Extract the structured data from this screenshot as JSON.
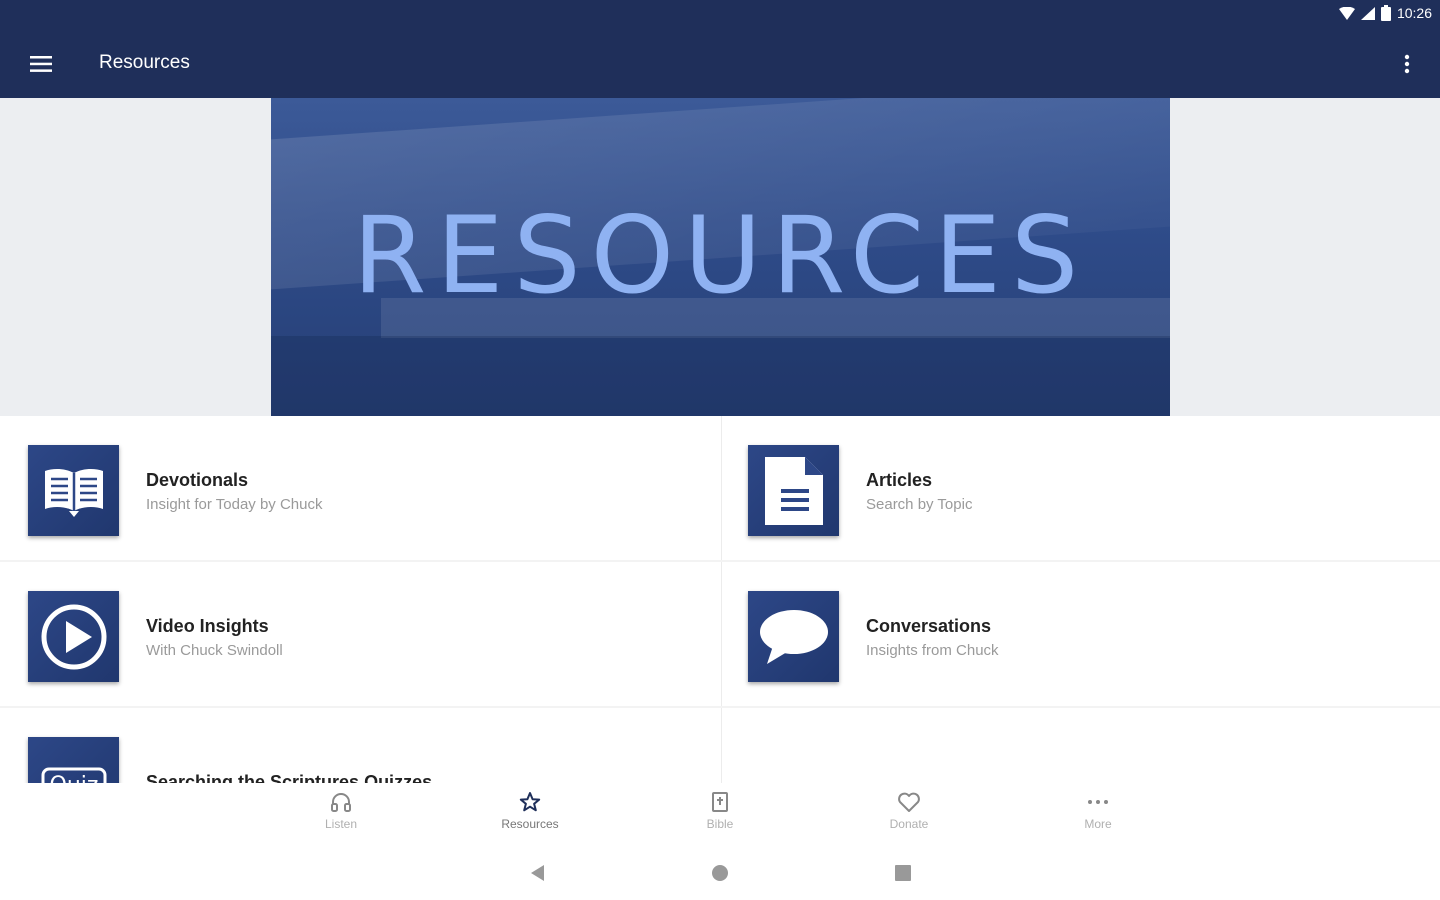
{
  "status_bar": {
    "time": "10:26"
  },
  "app_bar": {
    "title": "Resources"
  },
  "hero": {
    "text": "RESOURCES"
  },
  "tiles": [
    {
      "title": "Devotionals",
      "subtitle": "Insight for Today by Chuck",
      "icon": "open-book-icon"
    },
    {
      "title": "Articles",
      "subtitle": "Search by Topic",
      "icon": "document-icon"
    },
    {
      "title": "Video Insights",
      "subtitle": "With Chuck Swindoll",
      "icon": "play-circle-icon"
    },
    {
      "title": "Conversations",
      "subtitle": "Insights from Chuck",
      "icon": "speech-bubble-icon"
    },
    {
      "title": "Searching the Scriptures Quizzes",
      "subtitle": "",
      "icon": "quiz-icon"
    }
  ],
  "bottom_nav": [
    {
      "label": "Listen",
      "icon": "headphones-icon"
    },
    {
      "label": "Resources",
      "icon": "star-icon",
      "active": true
    },
    {
      "label": "Bible",
      "icon": "bible-icon"
    },
    {
      "label": "Donate",
      "icon": "heart-icon"
    },
    {
      "label": "More",
      "icon": "more-dots-icon"
    }
  ],
  "colors": {
    "primary": "#1f2f5a",
    "tile_icon": "#2d4787",
    "hero_text": "#8fb2f2"
  }
}
